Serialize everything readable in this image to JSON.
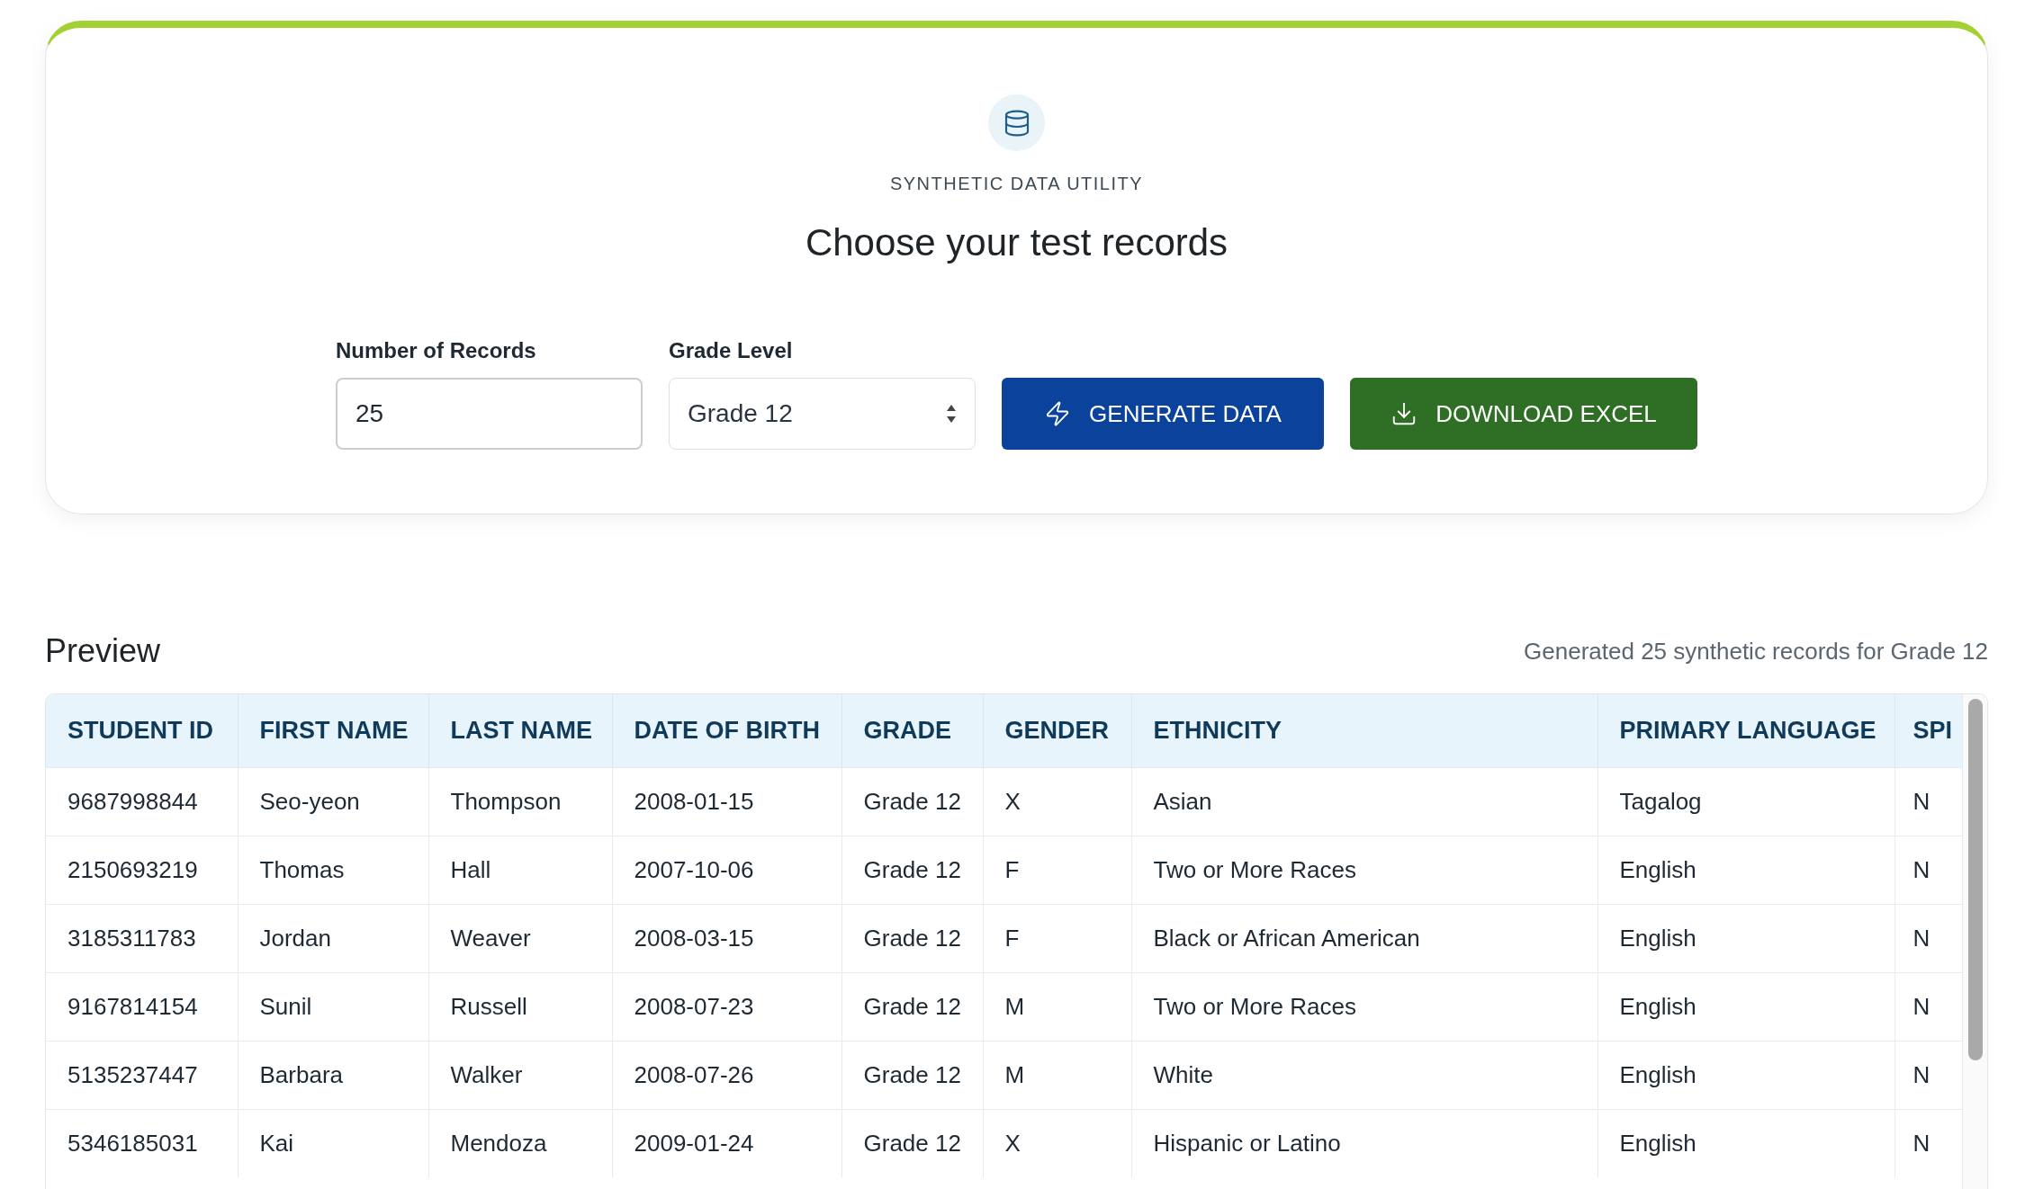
{
  "header": {
    "eyebrow": "SYNTHETIC DATA UTILITY",
    "title": "Choose your test records"
  },
  "form": {
    "records": {
      "label": "Number of Records",
      "value": "25"
    },
    "grade": {
      "label": "Grade Level",
      "value": "Grade 12"
    },
    "buttons": [
      {
        "kind": "generate",
        "label": "GENERATE DATA"
      },
      {
        "kind": "download",
        "label": "DOWNLOAD EXCEL"
      }
    ]
  },
  "preview": {
    "title": "Preview",
    "summary": "Generated 25 synthetic records for Grade 12",
    "table": {
      "columns": [
        "STUDENT ID",
        "FIRST NAME",
        "LAST NAME",
        "DATE OF BIRTH",
        "GRADE",
        "GENDER",
        "ETHNICITY",
        "PRIMARY LANGUAGE",
        "SPI"
      ],
      "rows": [
        {
          "cells": [
            "9687998844",
            "Seo-yeon",
            "Thompson",
            "2008-01-15",
            "Grade 12",
            "X",
            "Asian",
            "Tagalog",
            "N"
          ]
        },
        {
          "cells": [
            "2150693219",
            "Thomas",
            "Hall",
            "2007-10-06",
            "Grade 12",
            "F",
            "Two or More Races",
            "English",
            "N"
          ]
        },
        {
          "cells": [
            "3185311783",
            "Jordan",
            "Weaver",
            "2008-03-15",
            "Grade 12",
            "F",
            "Black or African American",
            "English",
            "N"
          ]
        },
        {
          "cells": [
            "9167814154",
            "Sunil",
            "Russell",
            "2008-07-23",
            "Grade 12",
            "M",
            "Two or More Races",
            "English",
            "N"
          ]
        },
        {
          "cells": [
            "5135237447",
            "Barbara",
            "Walker",
            "2008-07-26",
            "Grade 12",
            "M",
            "White",
            "English",
            "N"
          ]
        },
        {
          "cells": [
            "5346185031",
            "Kai",
            "Mendoza",
            "2009-01-24",
            "Grade 12",
            "X",
            "Hispanic or Latino",
            "English",
            "N"
          ]
        }
      ]
    }
  }
}
